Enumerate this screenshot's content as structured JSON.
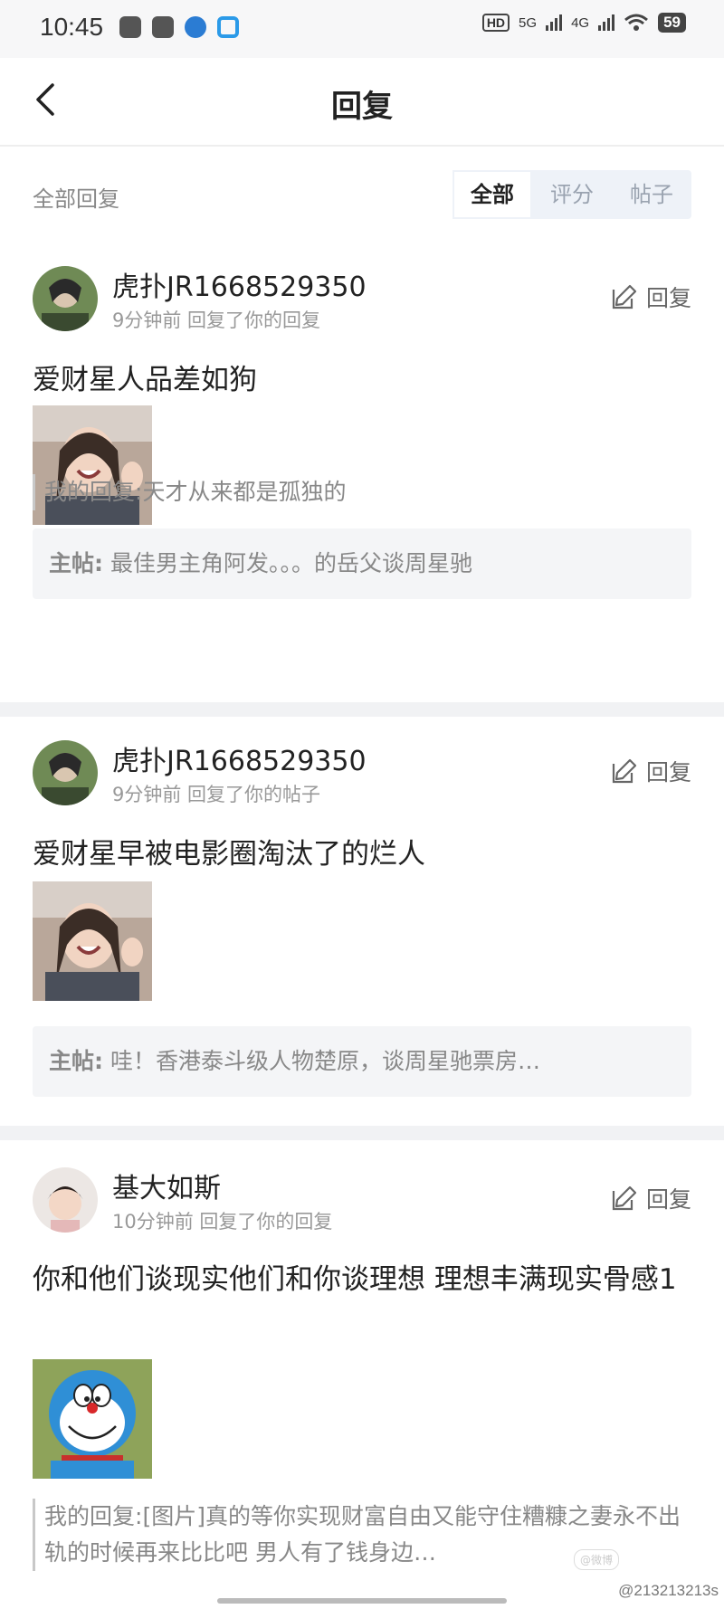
{
  "status_bar": {
    "time": "10:45",
    "network_1": "5G",
    "network_2": "4G",
    "hd": "HD",
    "battery": "59"
  },
  "header": {
    "title": "回复"
  },
  "filter": {
    "label": "全部回复",
    "tabs": [
      "全部",
      "评分",
      "帖子"
    ],
    "active_tab": "全部"
  },
  "reply_action_label": "回复",
  "mainpost_label": "主帖:",
  "myreply_label": "我的回复:",
  "cards": [
    {
      "username": "虎扑JR1668529350",
      "meta": "9分钟前  回复了你的回复",
      "content": "爱财星人品差如狗",
      "image": "laughing-girl-photo",
      "my_reply": "天才从来都是孤独的",
      "main_post": "最佳男主角阿发。。。的岳父谈周星驰"
    },
    {
      "username": "虎扑JR1668529350",
      "meta": "9分钟前  回复了你的帖子",
      "content": "爱财星早被电影圈淘汰了的烂人",
      "image": "laughing-girl-photo",
      "main_post": "哇！香港泰斗级人物楚原，谈周星驰票房…"
    },
    {
      "username": "基大如斯",
      "meta": "10分钟前  回复了你的回复",
      "content": "你和他们谈现实他们和你谈理想 理想丰满现实骨感1",
      "image": "doraemon-picture",
      "my_reply": "[图片]真的等你实现财富自由又能守住糟糠之妻永不出轨的时候再来比比吧 男人有了钱身边…"
    }
  ],
  "watermark": "@213213213s",
  "watermark_logo": "@微博"
}
